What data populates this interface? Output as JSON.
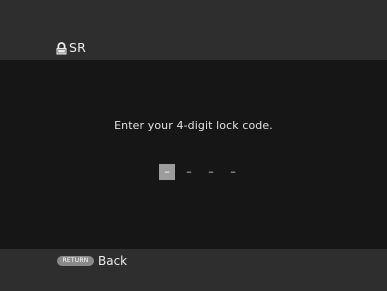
{
  "header": {
    "title": "SR",
    "icon": "lock-icon"
  },
  "prompt": "Enter your 4-digit lock code.",
  "code": {
    "digits": [
      "–",
      "–",
      "–",
      "–"
    ],
    "active_index": 0
  },
  "footer": {
    "return_key_label": "RETURN",
    "back_label": "Back"
  },
  "colors": {
    "background": "#161616",
    "bar": "#2e2e2e",
    "active_digit": "#9c9c9c"
  }
}
